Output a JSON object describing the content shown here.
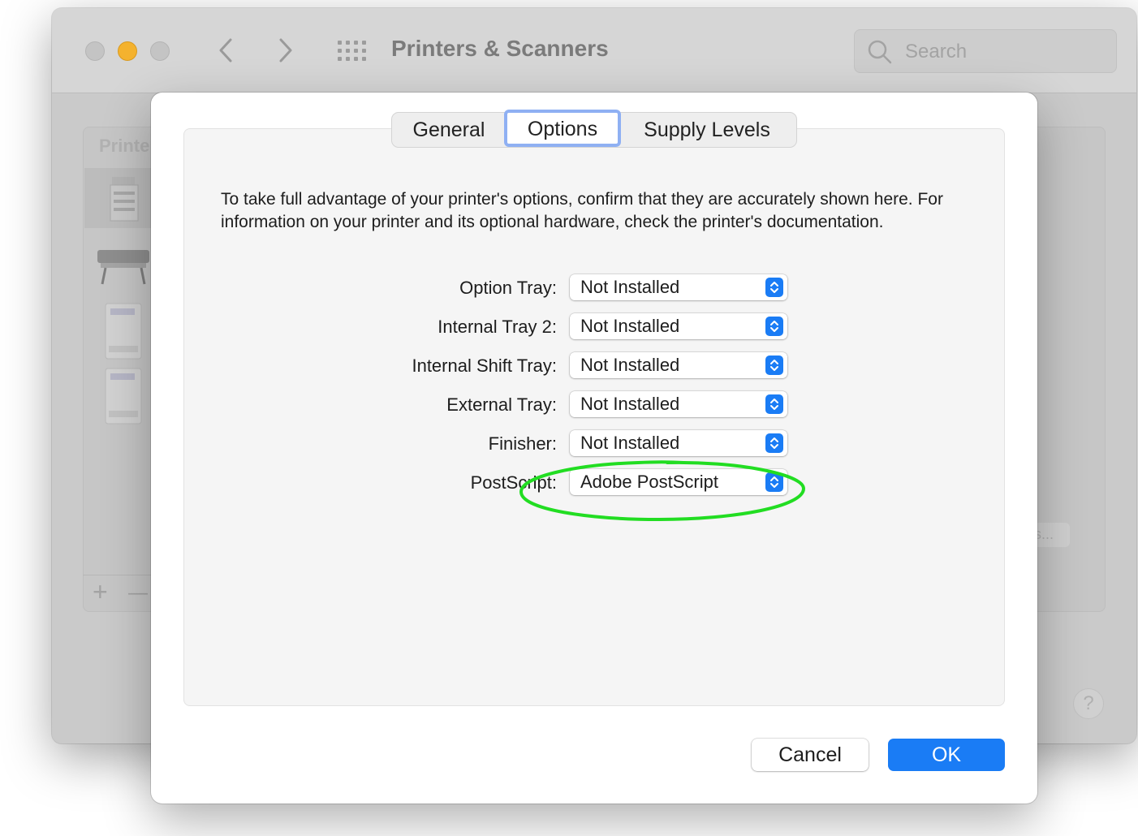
{
  "window": {
    "title": "Printers & Scanners",
    "search_placeholder": "Search",
    "list_header": "Printe",
    "add_label": "+",
    "remove_label": "—",
    "partial_button": "s...",
    "help_label": "?"
  },
  "sheet": {
    "tabs": [
      {
        "label": "General"
      },
      {
        "label": "Options"
      },
      {
        "label": "Supply Levels"
      }
    ],
    "selected_tab": "Options",
    "description": "To take full advantage of your printer's options, confirm that they are accurately shown here. For information on your printer and its optional hardware, check the printer's documentation.",
    "options": [
      {
        "label": "Option Tray:",
        "value": "Not Installed"
      },
      {
        "label": "Internal Tray 2:",
        "value": "Not Installed"
      },
      {
        "label": "Internal Shift Tray:",
        "value": "Not Installed"
      },
      {
        "label": "External Tray:",
        "value": "Not Installed"
      },
      {
        "label": "Finisher:",
        "value": "Not Installed"
      },
      {
        "label": "PostScript:",
        "value": "Adobe PostScript"
      }
    ],
    "cancel_label": "Cancel",
    "ok_label": "OK"
  },
  "colors": {
    "accent": "#1a7cf5",
    "annotation_ellipse": "#22dd22",
    "minimize_light": "#f4b22e"
  },
  "icons": [
    "back-chevron-icon",
    "forward-chevron-icon",
    "grid-icon",
    "search-icon",
    "popup-updown-icon"
  ]
}
